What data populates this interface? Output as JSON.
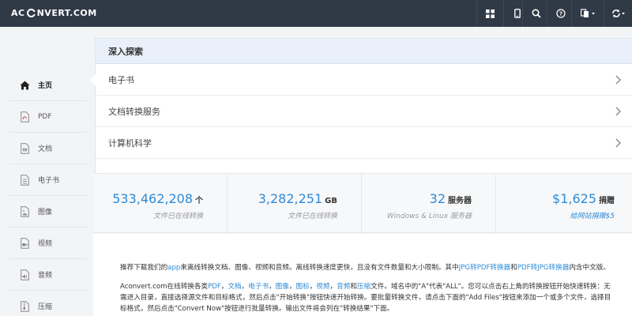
{
  "header": {
    "logo_left": "AC",
    "logo_right": "NVERT.COM",
    "buttons": [
      {
        "icon": "grid-icon"
      },
      {
        "icon": "mobile-icon"
      },
      {
        "icon": "search-icon"
      },
      {
        "icon": "help-icon"
      },
      {
        "icon": "language-icon"
      },
      {
        "icon": "refresh-icon"
      }
    ]
  },
  "sidebar": {
    "items": [
      {
        "label": "主页",
        "icon": "home-icon",
        "active": true
      },
      {
        "label": "PDF",
        "icon": "pdf-file-icon"
      },
      {
        "label": "文档",
        "icon": "word-file-icon"
      },
      {
        "label": "电子书",
        "icon": "ebook-file-icon"
      },
      {
        "label": "图像",
        "icon": "image-file-icon"
      },
      {
        "label": "视频",
        "icon": "video-file-icon"
      },
      {
        "label": "音频",
        "icon": "audio-file-icon"
      },
      {
        "label": "压缩",
        "icon": "archive-file-icon"
      }
    ]
  },
  "explore": {
    "title": "深入探索",
    "rows": [
      "电子书",
      "文档转换服务",
      "计算机科学"
    ]
  },
  "stats": [
    {
      "value": "533,462,208",
      "unit": "个",
      "caption": "文件已在线转换"
    },
    {
      "value": "3,282,251",
      "unit": "GB",
      "caption": "文件已在线转换"
    },
    {
      "value": "32",
      "unit": "服务器",
      "caption": "Windows & Linux 服务器"
    },
    {
      "value": "$1,625",
      "unit": "捐赠",
      "caption": "给网站捐赠$5"
    }
  ],
  "content": {
    "p1_a": "推荐下载我们的",
    "p1_link1": "app",
    "p1_b": "来离线转换文档、图像、视频和音频。离线转换速度更快，且没有文件数量和大小限制。其中",
    "p1_link2": "JPG转PDF转换器",
    "p1_c": "和",
    "p1_link3": "PDF转JPG转换器",
    "p1_d": "内含中文版。",
    "p2_a": "Aconvert.com在线转换各类",
    "p2_l1": "PDF",
    "p2_s1": "，",
    "p2_l2": "文档",
    "p2_s2": "，",
    "p2_l3": "电子书",
    "p2_s3": "，",
    "p2_l4": "图像",
    "p2_s4": "，",
    "p2_l5": "图标",
    "p2_s5": "，",
    "p2_l6": "视频",
    "p2_s6": "，",
    "p2_l7": "音频",
    "p2_s7": "和",
    "p2_l8": "压缩",
    "p2_b": "文件。域名中的\"A\"代表\"ALL\"。您可以点击右上角的转换按钮开始快速转换：无需进入目录，直接选择源文件和目标格式，然后点击\"开始转换\"按钮快速开始转换。要批量转换文件，请点击下面的\"Add Files\"按钮来添加一个或多个文件，选择目标格式，然后点击\"Convert Now\"按钮进行批量转换。输出文件将会列在\"转换结果\"下面。"
  },
  "colors": {
    "topbar": "#303946",
    "accent": "#2e8bd6",
    "explore_header": "#e9f0fa"
  }
}
